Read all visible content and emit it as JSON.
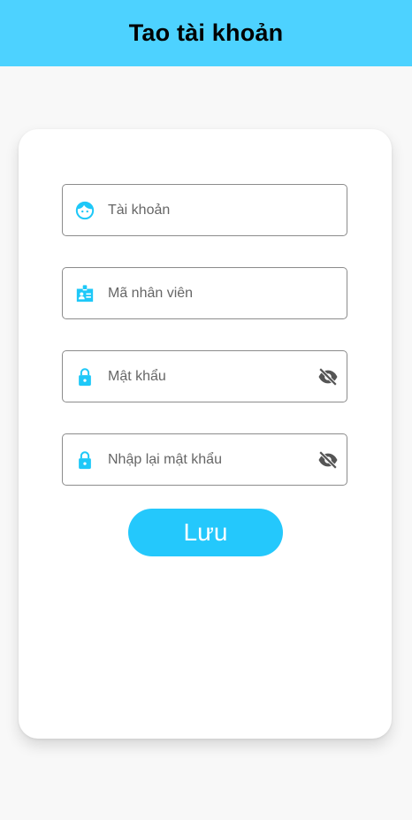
{
  "header": {
    "title": "Tao tài khoản"
  },
  "form": {
    "fields": [
      {
        "name": "username",
        "placeholder": "Tài khoản",
        "icon": "face-icon"
      },
      {
        "name": "employee_id",
        "placeholder": "Mã nhân viên",
        "icon": "badge-icon"
      },
      {
        "name": "password",
        "placeholder": "Mật khẩu",
        "icon": "lock-icon",
        "toggle_icon": "visibility-off-icon"
      },
      {
        "name": "confirm_password",
        "placeholder": "Nhập lại mật khẩu",
        "icon": "lock-icon",
        "toggle_icon": "visibility-off-icon"
      }
    ],
    "save_label": "Lưu"
  },
  "colors": {
    "app_bar": "#4dd2ff",
    "accent": "#24c8fc",
    "icon": "#1ec8f8",
    "background": "#f8f8f8"
  }
}
